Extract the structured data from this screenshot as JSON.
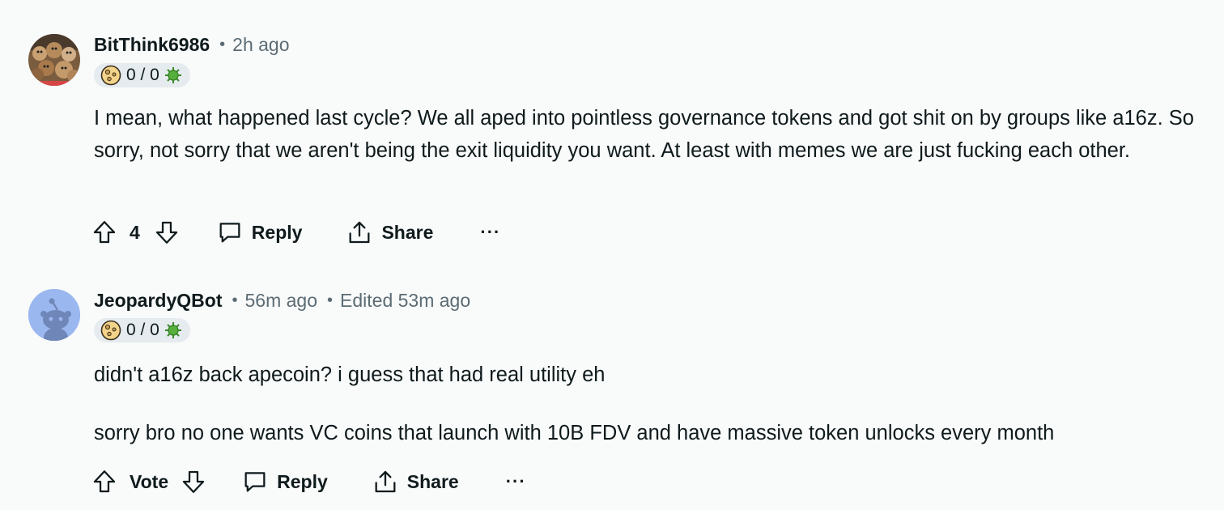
{
  "comments": [
    {
      "author": "BitThink6986",
      "time": "2h ago",
      "edited": "",
      "flair_text": "0 / 0",
      "body": [
        "I mean, what happened last cycle? We all aped into pointless governance tokens and got shit on by groups like a16z. So sorry, not sorry that we aren't being the exit liquidity you want. At least with memes we are just fucking each other."
      ],
      "vote_label": "4",
      "reply_label": "Reply",
      "share_label": "Share",
      "more_label": "···"
    },
    {
      "author": "JeopardyQBot",
      "time": "56m ago",
      "edited": "Edited 53m ago",
      "flair_text": "0 / 0",
      "body": [
        "didn't a16z back apecoin? i guess that had real utility eh",
        "sorry bro no one wants VC coins that launch with 10B FDV and have massive token unlocks every month"
      ],
      "vote_label": "Vote",
      "reply_label": "Reply",
      "share_label": "Share",
      "more_label": "···"
    }
  ],
  "icons": {
    "upvote": "upvote-arrow-icon",
    "downvote": "downvote-arrow-icon",
    "reply": "comment-bubble-icon",
    "share": "share-icon",
    "more": "more-dots-icon",
    "flair_moon": "moon-icon",
    "flair_virus": "virus-icon"
  },
  "colors": {
    "background": "#f9fafa",
    "text": "#0f1a1c",
    "meta": "#5c6c74",
    "flair_bg": "#e5ebee",
    "snoo_avatar_bg": "#9bb7f0"
  }
}
